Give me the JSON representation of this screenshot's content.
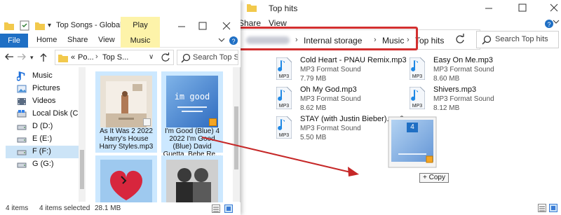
{
  "back_window": {
    "title": "Top hits",
    "tabs": [
      "Share",
      "View"
    ],
    "breadcrumb": [
      "Internal storage",
      "Music",
      "Top hits"
    ],
    "search_placeholder": "Search Top hits",
    "files": [
      {
        "name": "Cold Heart - PNAU Remix.mp3",
        "type": "MP3 Format Sound",
        "size": "7.79 MB"
      },
      {
        "name": "Easy On Me.mp3",
        "type": "MP3 Format Sound",
        "size": "8.60 MB"
      },
      {
        "name": "Oh My God.mp3",
        "type": "MP3 Format Sound",
        "size": "8.62 MB"
      },
      {
        "name": "Shivers.mp3",
        "type": "MP3 Format Sound",
        "size": "8.12 MB"
      },
      {
        "name": "STAY (with Justin Bieber).mp3",
        "type": "MP3 Format Sound",
        "size": "5.50 MB"
      }
    ],
    "icon_label": "MP3"
  },
  "front_window": {
    "title": "Top Songs - Global",
    "play_context": "Play",
    "ribbon": {
      "file": "File",
      "home": "Home",
      "share": "Share",
      "view": "View",
      "music_tools": "Music Tools"
    },
    "address": {
      "prefix": "«",
      "part1": "Po...",
      "part2": "Top S..."
    },
    "search_placeholder": "Search Top Songs",
    "sidebar": [
      {
        "label": "Music",
        "icon": "music-note-icon",
        "selected": false
      },
      {
        "label": "Pictures",
        "icon": "pictures-icon",
        "selected": false
      },
      {
        "label": "Videos",
        "icon": "videos-icon",
        "selected": false
      },
      {
        "label": "Local Disk (C:)",
        "icon": "drive-icon",
        "selected": false
      },
      {
        "label": "D (D:)",
        "icon": "drive-icon",
        "selected": false
      },
      {
        "label": "E (E:)",
        "icon": "drive-icon",
        "selected": false
      },
      {
        "label": "F (F:)",
        "icon": "drive-icon",
        "selected": true
      },
      {
        "label": "G (G:)",
        "icon": "drive-icon",
        "selected": false
      }
    ],
    "thumbnails": [
      {
        "caption": "As It Was 2 2022 Harry's House Harry Styles.mp3"
      },
      {
        "caption": "I'm Good (Blue) 4 2022 I'm Good (Blue) David Guetta, Bebe Re..."
      },
      {
        "caption": ""
      },
      {
        "caption": ""
      }
    ],
    "album_text": "im good",
    "status": {
      "items": "4 items",
      "selected": "4 items selected",
      "size": "28.1 MB"
    }
  },
  "drag": {
    "badge_count": "4",
    "tooltip": "+ Copy"
  },
  "colors": {
    "accent_blue": "#1f6fc4",
    "highlight_red": "#d32f2f",
    "selection": "#cce8ff",
    "play_tab": "#fdf3a9"
  }
}
